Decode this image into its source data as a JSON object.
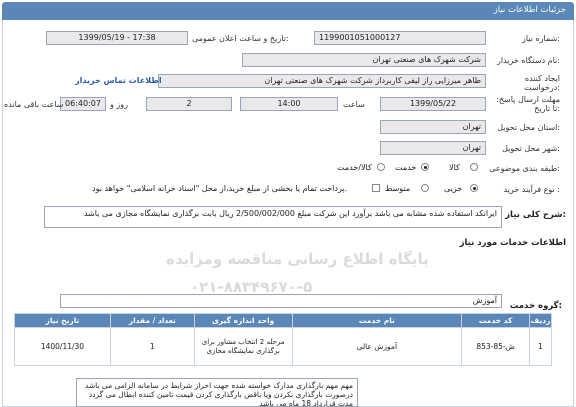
{
  "window": {
    "title": "جزئیات اطلاعات نیاز"
  },
  "form": {
    "need_number_label": "شماره نیاز:",
    "need_number": "1199001051000127",
    "announce_label": "تاریخ و ساعت اعلان عمومی:",
    "announce_value": "1399/05/19 - 17:38",
    "buyer_label": "نام دستگاه خریدار:",
    "buyer_value": "شرکت شهرک های صنعتی تهران",
    "creator_label": "ایجاد کننده درخواست:",
    "creator_value": "طاهر  میرزایی راز لیقی کاربرداز  شرکت شهرک های صنعتی تهران",
    "contact_link": "اطلاعات تماس خریدار",
    "deadline_label": "مهلت ارسال پاسخ: تا تاریخ:",
    "deadline_date": "1399/05/22",
    "time_label": "ساعت",
    "deadline_time": "14:00",
    "day_label": "روز و",
    "days": "2",
    "remaining_time": "06:40:07",
    "remaining_label": "ساعت باقی مانده",
    "province_label": "استان محل تحویل:",
    "province_value": "تهران",
    "city_label": "شهر محل تحویل:",
    "city_value": "تهران",
    "category_label": "طبقه بندی موضوعی:",
    "category_options": [
      "کالا",
      "خدمت",
      "کالا/خدمت"
    ],
    "category_selected": "خدمت",
    "process_label": "نوع فرآیند خرید :",
    "process_options": [
      "جزیی",
      "متوسط"
    ],
    "process_selected": "جزیی",
    "payment_note": "پرداخت تمام یا بخشی از مبلغ خرید،از محل \"اسناد خزانه اسلامی\" خواهد بود."
  },
  "description": {
    "label": "شرح کلی نیاز:",
    "text": "ایرانکد استفاده شده مشابه می باشد برآورد این شرکت مبلغ 2/500/002/000 ریال بابت برگذاری نمایشگاه مجازی می باشد"
  },
  "services_section": {
    "title": "اطلاعات خدمات مورد نیاز"
  },
  "service_group": {
    "label": "گروه خدمت:",
    "value": "آموزش"
  },
  "watermark": {
    "line1": "پایگاه اطلاع رسانی مناقصه ومزایده",
    "line2": "۰۲۱-۸۸۳۴۹۶۷۰-۵"
  },
  "table": {
    "headers": [
      "ردیف",
      "کد خدمت",
      "نام خدمت",
      "واحد اندازه گیری",
      "تعداد / مقدار",
      "تاریخ نیاز"
    ],
    "rows": [
      [
        "1",
        "ش-85-853",
        "آموزش عالی",
        "مرحله 2 انتخاب مشاور برای برگذاری نمایشگاه مجازی",
        "1",
        "1400/11/30"
      ]
    ]
  },
  "note": {
    "text": "مهم مهم بارگذاری مدارک خواسته شده جهت احراز شرایط در سامانه الزامی می باشد درصورت بارگذاری نکردن ویا ناقص بارگذاری کردن قیمت تامین کننده ابطال می گردد مدت قرارداد 18 ماه می باشد"
  },
  "colors": {
    "header_bg": "#5a86b8",
    "link": "#2a5db0"
  }
}
